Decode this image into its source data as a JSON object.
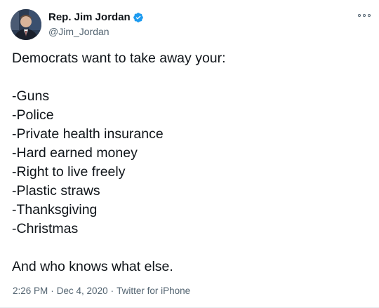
{
  "author": {
    "display_name": "Rep. Jim Jordan",
    "handle": "@Jim_Jordan",
    "verified": true,
    "verified_color": "#1d9bf0"
  },
  "tweet": {
    "lines": [
      "Democrats want to take away your:",
      "",
      "-Guns",
      "-Police",
      "-Private health insurance",
      "-Hard earned money",
      "-Right to live freely",
      "-Plastic straws",
      "-Thanksgiving",
      "-Christmas",
      "",
      "And who knows what else."
    ]
  },
  "meta": {
    "time": "2:26 PM",
    "date": "Dec 4, 2020",
    "source": "Twitter for iPhone",
    "separator": "·"
  },
  "icons": {
    "more": "more-options-icon",
    "verified": "verified-badge-icon"
  }
}
